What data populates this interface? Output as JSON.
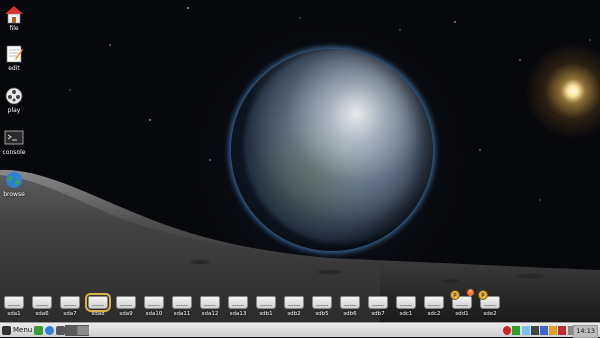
{
  "desktop": {
    "icons": [
      {
        "name": "file",
        "icon": "home-icon"
      },
      {
        "name": "edit",
        "icon": "notepad-icon"
      },
      {
        "name": "play",
        "icon": "film-reel-icon"
      },
      {
        "name": "console",
        "icon": "terminal-icon"
      },
      {
        "name": "browse",
        "icon": "globe-icon"
      }
    ],
    "drives": [
      "sda1",
      "sda6",
      "sda7",
      "sda8",
      "sda9",
      "sda10",
      "sda11",
      "sda12",
      "sda13",
      "sdb1",
      "sdb2",
      "sdb5",
      "sdb6",
      "sdb7",
      "sdc1",
      "sdc2",
      "sdd1",
      "sde2"
    ],
    "selected_drive": "sda8",
    "mounted_badge": "p"
  },
  "taskbar": {
    "menu_label": "Menu",
    "clock": "14:13",
    "colors": {
      "accent": "#d9b24a",
      "panel": "#dcdcdc",
      "planet_glow": "#5aa0e6"
    }
  }
}
